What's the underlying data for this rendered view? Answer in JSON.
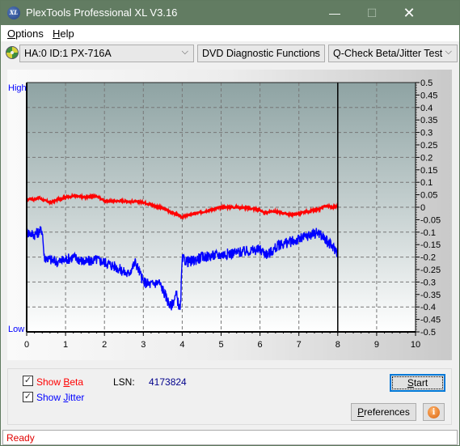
{
  "window": {
    "title": "PlexTools Professional XL V3.16",
    "icon_label": "XL",
    "minimize_glyph": "—",
    "maximize_glyph": "☐",
    "close_glyph": "✕"
  },
  "menu": {
    "items": [
      {
        "label": "Options",
        "accel": "O"
      },
      {
        "label": "Help",
        "accel": "H"
      }
    ]
  },
  "toolbar": {
    "drive": "HA:0 ID:1  PX-716A",
    "function": "DVD Diagnostic Functions",
    "test": "Q-Check Beta/Jitter Test",
    "arrow_glyph": "⌵"
  },
  "chart_data": {
    "type": "line",
    "title": "",
    "xlabel": "",
    "ylabel": "",
    "left_axis_labels": {
      "top": "High",
      "bottom": "Low"
    },
    "xlim": [
      0,
      10
    ],
    "ylim": [
      -0.5,
      0.5
    ],
    "x_ticks": [
      0,
      1,
      2,
      3,
      4,
      5,
      6,
      7,
      8,
      9,
      10
    ],
    "y_ticks": [
      0.5,
      0.45,
      0.4,
      0.35,
      0.3,
      0.25,
      0.2,
      0.15,
      0.1,
      0.05,
      0,
      -0.05,
      -0.1,
      -0.15,
      -0.2,
      -0.25,
      -0.3,
      -0.35,
      -0.4,
      -0.45,
      -0.5
    ],
    "grid": true,
    "position_marker_x": 8,
    "series": [
      {
        "name": "Beta",
        "color": "#ff0000",
        "x": [
          0,
          0.1,
          0.2,
          0.3,
          0.4,
          0.5,
          0.6,
          0.8,
          1.0,
          1.2,
          1.5,
          1.8,
          2.0,
          2.5,
          3.0,
          3.5,
          3.8,
          4.0,
          4.2,
          4.5,
          5.0,
          5.5,
          6.0,
          6.1,
          6.3,
          6.5,
          6.8,
          7.0,
          7.3,
          7.5,
          7.6,
          7.7,
          7.9,
          8.0
        ],
        "values": [
          0.03,
          0.035,
          0.03,
          0.04,
          0.03,
          0.025,
          0.02,
          0.03,
          0.04,
          0.045,
          0.04,
          0.045,
          0.025,
          0.025,
          0.02,
          -0.005,
          -0.025,
          -0.04,
          -0.03,
          -0.02,
          0.0,
          0.0,
          -0.01,
          -0.025,
          -0.015,
          -0.02,
          -0.03,
          -0.025,
          -0.015,
          -0.01,
          0.0,
          0.005,
          0.0,
          0.005
        ]
      },
      {
        "name": "Jitter",
        "color": "#0000ff",
        "x": [
          0,
          0.2,
          0.4,
          0.45,
          0.6,
          0.8,
          1.0,
          1.2,
          1.5,
          1.8,
          2.0,
          2.3,
          2.6,
          2.8,
          3.0,
          3.2,
          3.4,
          3.5,
          3.7,
          3.85,
          3.95,
          4.0,
          4.2,
          4.5,
          5.0,
          5.5,
          6.0,
          6.2,
          6.5,
          7.0,
          7.3,
          7.5,
          7.8,
          8.0
        ],
        "values": [
          -0.1,
          -0.11,
          -0.09,
          -0.2,
          -0.21,
          -0.22,
          -0.21,
          -0.2,
          -0.22,
          -0.21,
          -0.22,
          -0.24,
          -0.27,
          -0.22,
          -0.3,
          -0.31,
          -0.3,
          -0.33,
          -0.4,
          -0.35,
          -0.42,
          -0.21,
          -0.22,
          -0.2,
          -0.19,
          -0.18,
          -0.17,
          -0.19,
          -0.15,
          -0.13,
          -0.11,
          -0.1,
          -0.15,
          -0.18
        ]
      }
    ]
  },
  "controls": {
    "show_beta": {
      "label_pre": "Show ",
      "label_accel": "B",
      "label_post": "eta",
      "checked": true,
      "color": "#ff0000"
    },
    "show_jitter": {
      "label_pre": "Show ",
      "label_accel": "J",
      "label_post": "itter",
      "checked": true,
      "color": "#0000ff"
    },
    "check_glyph": "✓",
    "lsn_label": "LSN:",
    "lsn_value": "4173824",
    "start_accel": "S",
    "start_rest": "tart",
    "preferences_accel": "P",
    "preferences_rest": "references",
    "info_glyph": "i"
  },
  "status": {
    "text": "Ready"
  }
}
